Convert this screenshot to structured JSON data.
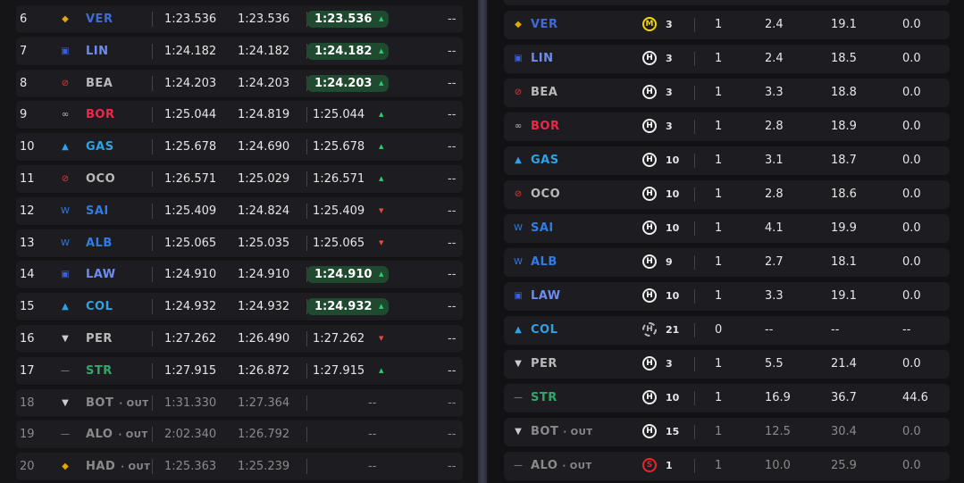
{
  "colors": {
    "best": "#1f4a30",
    "up": "#2ecc71",
    "down": "#e74c3c"
  },
  "timing": {
    "rows": [
      {
        "pos": "6",
        "team_icon": "redbull-icon",
        "driver": "VER",
        "out": "",
        "lap1": "1:23.536",
        "lap2": "1:23.536",
        "lap3": "1:23.536",
        "best": true,
        "trend": "up",
        "gap": "--",
        "color": "#3e6bd6"
      },
      {
        "pos": "7",
        "team_icon": "racingbulls-icon",
        "driver": "LIN",
        "out": "",
        "lap1": "1:24.182",
        "lap2": "1:24.182",
        "lap3": "1:24.182",
        "best": true,
        "trend": "up",
        "gap": "--",
        "color": "#6c8cf0"
      },
      {
        "pos": "8",
        "team_icon": "haas-icon",
        "driver": "BEA",
        "out": "",
        "lap1": "1:24.203",
        "lap2": "1:24.203",
        "lap3": "1:24.203",
        "best": true,
        "trend": "up",
        "gap": "--",
        "color": "#b9b9b9"
      },
      {
        "pos": "9",
        "team_icon": "audi-icon",
        "driver": "BOR",
        "out": "",
        "lap1": "1:25.044",
        "lap2": "1:24.819",
        "lap3": "1:25.044",
        "best": false,
        "trend": "up",
        "gap": "--",
        "color": "#f0264a"
      },
      {
        "pos": "10",
        "team_icon": "alpine-icon",
        "driver": "GAS",
        "out": "",
        "lap1": "1:25.678",
        "lap2": "1:24.690",
        "lap3": "1:25.678",
        "best": false,
        "trend": "up",
        "gap": "--",
        "color": "#2aa3e8"
      },
      {
        "pos": "11",
        "team_icon": "haas-icon",
        "driver": "OCO",
        "out": "",
        "lap1": "1:26.571",
        "lap2": "1:25.029",
        "lap3": "1:26.571",
        "best": false,
        "trend": "up",
        "gap": "--",
        "color": "#b9b9b9"
      },
      {
        "pos": "12",
        "team_icon": "williams-icon",
        "driver": "SAI",
        "out": "",
        "lap1": "1:25.409",
        "lap2": "1:24.824",
        "lap3": "1:25.409",
        "best": false,
        "trend": "down",
        "gap": "--",
        "color": "#2f7be8"
      },
      {
        "pos": "13",
        "team_icon": "williams-icon",
        "driver": "ALB",
        "out": "",
        "lap1": "1:25.065",
        "lap2": "1:25.035",
        "lap3": "1:25.065",
        "best": false,
        "trend": "down",
        "gap": "--",
        "color": "#2f7be8"
      },
      {
        "pos": "14",
        "team_icon": "racingbulls-icon",
        "driver": "LAW",
        "out": "",
        "lap1": "1:24.910",
        "lap2": "1:24.910",
        "lap3": "1:24.910",
        "best": true,
        "trend": "up",
        "gap": "--",
        "color": "#6c8cf0"
      },
      {
        "pos": "15",
        "team_icon": "alpine-icon",
        "driver": "COL",
        "out": "",
        "lap1": "1:24.932",
        "lap2": "1:24.932",
        "lap3": "1:24.932",
        "best": true,
        "trend": "up",
        "gap": "--",
        "color": "#2aa3e8"
      },
      {
        "pos": "16",
        "team_icon": "cadillac-icon",
        "driver": "PER",
        "out": "",
        "lap1": "1:27.262",
        "lap2": "1:26.490",
        "lap3": "1:27.262",
        "best": false,
        "trend": "down",
        "gap": "--",
        "color": "#b9b9b9"
      },
      {
        "pos": "17",
        "team_icon": "astonmartin-icon",
        "driver": "STR",
        "out": "",
        "lap1": "1:27.915",
        "lap2": "1:26.872",
        "lap3": "1:27.915",
        "best": false,
        "trend": "up",
        "gap": "--",
        "color": "#2ea86b"
      },
      {
        "pos": "18",
        "team_icon": "cadillac-icon",
        "driver": "BOT",
        "out": "· OUT",
        "lap1": "1:31.330",
        "lap2": "1:27.364",
        "lap3": "--",
        "best": false,
        "trend": "",
        "gap": "--",
        "color": "#8a8a8a"
      },
      {
        "pos": "19",
        "team_icon": "astonmartin-icon",
        "driver": "ALO",
        "out": "· OUT",
        "lap1": "2:02.340",
        "lap2": "1:26.792",
        "lap3": "--",
        "best": false,
        "trend": "",
        "gap": "--",
        "color": "#8a8a8a"
      },
      {
        "pos": "20",
        "team_icon": "redbull-icon",
        "driver": "HAD",
        "out": "· OUT",
        "lap1": "1:25.363",
        "lap2": "1:25.239",
        "lap3": "--",
        "best": false,
        "trend": "",
        "gap": "--",
        "color": "#8a8a8a"
      }
    ]
  },
  "stints": {
    "rows": [
      {
        "team_icon": "redbull-icon",
        "driver": "VER",
        "out": "",
        "tyre": "M",
        "tyre_type": "med",
        "laps": "3",
        "pits": "1",
        "c1": "2.4",
        "c2": "19.1",
        "c3": "0.0",
        "color": "#3e6bd6"
      },
      {
        "team_icon": "racingbulls-icon",
        "driver": "LIN",
        "out": "",
        "tyre": "H",
        "tyre_type": "hard",
        "laps": "3",
        "pits": "1",
        "c1": "2.4",
        "c2": "18.5",
        "c3": "0.0",
        "color": "#6c8cf0"
      },
      {
        "team_icon": "haas-icon",
        "driver": "BEA",
        "out": "",
        "tyre": "H",
        "tyre_type": "hard",
        "laps": "3",
        "pits": "1",
        "c1": "3.3",
        "c2": "18.8",
        "c3": "0.0",
        "color": "#b9b9b9"
      },
      {
        "team_icon": "audi-icon",
        "driver": "BOR",
        "out": "",
        "tyre": "H",
        "tyre_type": "hard",
        "laps": "3",
        "pits": "1",
        "c1": "2.8",
        "c2": "18.9",
        "c3": "0.0",
        "color": "#f0264a"
      },
      {
        "team_icon": "alpine-icon",
        "driver": "GAS",
        "out": "",
        "tyre": "H",
        "tyre_type": "hard",
        "laps": "10",
        "pits": "1",
        "c1": "3.1",
        "c2": "18.7",
        "c3": "0.0",
        "color": "#2aa3e8"
      },
      {
        "team_icon": "haas-icon",
        "driver": "OCO",
        "out": "",
        "tyre": "H",
        "tyre_type": "hard",
        "laps": "10",
        "pits": "1",
        "c1": "2.8",
        "c2": "18.6",
        "c3": "0.0",
        "color": "#b9b9b9"
      },
      {
        "team_icon": "williams-icon",
        "driver": "SAI",
        "out": "",
        "tyre": "H",
        "tyre_type": "hard",
        "laps": "10",
        "pits": "1",
        "c1": "4.1",
        "c2": "19.9",
        "c3": "0.0",
        "color": "#2f7be8"
      },
      {
        "team_icon": "williams-icon",
        "driver": "ALB",
        "out": "",
        "tyre": "H",
        "tyre_type": "hard",
        "laps": "9",
        "pits": "1",
        "c1": "2.7",
        "c2": "18.1",
        "c3": "0.0",
        "color": "#2f7be8"
      },
      {
        "team_icon": "racingbulls-icon",
        "driver": "LAW",
        "out": "",
        "tyre": "H",
        "tyre_type": "hard",
        "laps": "10",
        "pits": "1",
        "c1": "3.3",
        "c2": "19.1",
        "c3": "0.0",
        "color": "#6c8cf0"
      },
      {
        "team_icon": "alpine-icon",
        "driver": "COL",
        "out": "",
        "tyre": "H",
        "tyre_type": "used",
        "laps": "21",
        "pits": "0",
        "c1": "--",
        "c2": "--",
        "c3": "--",
        "color": "#2aa3e8"
      },
      {
        "team_icon": "cadillac-icon",
        "driver": "PER",
        "out": "",
        "tyre": "H",
        "tyre_type": "hard",
        "laps": "3",
        "pits": "1",
        "c1": "5.5",
        "c2": "21.4",
        "c3": "0.0",
        "color": "#b9b9b9"
      },
      {
        "team_icon": "astonmartin-icon",
        "driver": "STR",
        "out": "",
        "tyre": "H",
        "tyre_type": "hard",
        "laps": "10",
        "pits": "1",
        "c1": "16.9",
        "c2": "36.7",
        "c3": "44.6",
        "color": "#2ea86b"
      },
      {
        "team_icon": "cadillac-icon",
        "driver": "BOT",
        "out": "· OUT",
        "tyre": "H",
        "tyre_type": "hard",
        "laps": "15",
        "pits": "1",
        "c1": "12.5",
        "c2": "30.4",
        "c3": "0.0",
        "color": "#8a8a8a"
      },
      {
        "team_icon": "astonmartin-icon",
        "driver": "ALO",
        "out": "· OUT",
        "tyre": "S",
        "tyre_type": "soft",
        "laps": "1",
        "pits": "1",
        "c1": "10.0",
        "c2": "25.9",
        "c3": "0.0",
        "color": "#8a8a8a"
      }
    ]
  }
}
